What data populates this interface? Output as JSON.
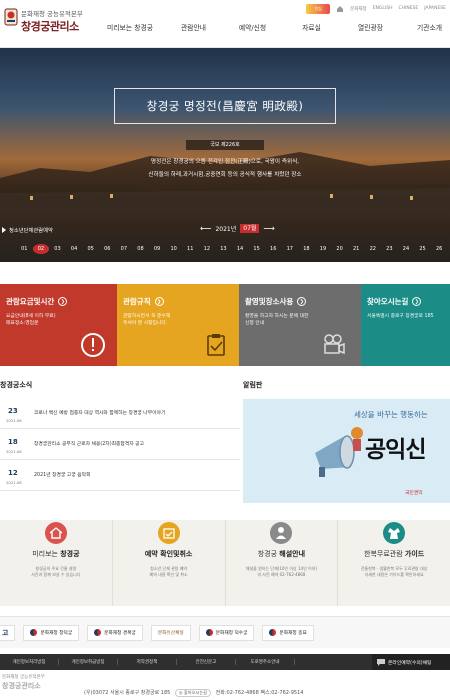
{
  "header": {
    "org": "문화재청 궁능유적본부",
    "site_name": "창경궁관리소",
    "util_links": [
      "홈",
      "문화재청",
      "ENGLISH",
      "CHINESE",
      "JAPANESE"
    ],
    "nav": [
      "미리보는 창경궁",
      "관람안내",
      "예약/신청",
      "자료실",
      "열린광장",
      "기관소개"
    ]
  },
  "hero": {
    "title": "창경궁 명정전(昌慶宮 明政殿)",
    "badge": "국보 제226호",
    "desc_line1": "명정전은 창경궁의 으뜸 전각인 정전(正殿)으로, 국왕이 즉위식,",
    "desc_line2": "신하들의 하례,과거시험,궁중연회 등의 공식적 행사를 치렀던 장소",
    "booking_label": "청소년단체관람예약",
    "year_label": "2021년",
    "month_label": "07월",
    "days": [
      "01",
      "02",
      "03",
      "04",
      "05",
      "06",
      "07",
      "08",
      "09",
      "10",
      "11",
      "12",
      "13",
      "14",
      "15",
      "16",
      "17",
      "18",
      "19",
      "20",
      "21",
      "22",
      "23",
      "24",
      "25",
      "26"
    ],
    "selected_day": "02"
  },
  "tiles": [
    {
      "title": "관람요금및시간",
      "desc": "요금안내(8세 이하 무료)\n매표정소:영업문",
      "color": "#c0392b"
    },
    {
      "title": "관람규칙",
      "desc": "관람하시면서 꼭 준수해\n주셔야 할 사항입니다.",
      "color": "#e6a520"
    },
    {
      "title": "촬영및장소사용",
      "desc": "촬영을 하고자 하시는 분에 대한\n신청 안내",
      "color": "#6d6d6d"
    },
    {
      "title": "찾아오시는길",
      "desc": "서울특별시 종로구 창경궁로 185",
      "color": "#1b8c86"
    }
  ],
  "news": {
    "title": "창경궁소식",
    "items": [
      {
        "day": "23",
        "ym": "2021.06",
        "text": "코로나 백신 예방 접종자 대상 역사와 함께하는 창경궁 나무이야기"
      },
      {
        "day": "18",
        "ym": "2021.06",
        "text": "창경궁관리소 공무직 근로자 채용(2차)최종합격자 공고"
      },
      {
        "day": "12",
        "ym": "2021.06",
        "text": "2021년 창경궁 고궁 음악회"
      }
    ]
  },
  "board": {
    "title": "알림판",
    "slogan": "세상을 바꾸는 행동하는",
    "big": "공익신",
    "foot": "국민권익"
  },
  "cards": [
    {
      "title_pre": "미리보는 ",
      "title_bold": "창경궁",
      "desc": "창경궁의 주요 건물 설명\n사진과 함께 보실 수 있습니다",
      "icon_color": "#d9534f"
    },
    {
      "title_pre": "예약 확인및취소",
      "title_bold": "",
      "desc": "청소년 단체 관람 예약\n예약 내용 확인 및 취소",
      "icon_color": "#e6a520"
    },
    {
      "title_pre": "창경궁 ",
      "title_bold": "해설안내",
      "desc": "해설을 원하는 단체(10인 이상 14인 이하)\n의 사전 예약 02-762-4868",
      "icon_color": "#7d7d7d"
    },
    {
      "title_pre": "한복무료관람 ",
      "title_bold": "가이드",
      "desc": "전통한복 · 생활한복 모두 무료관람 대상\n자세한 내용은 가이드를 확인하세요",
      "icon_color": "#1b8c86"
    }
  ],
  "partners": [
    "고",
    "문화재청 창덕궁",
    "문화재청 경복궁",
    "문화유산채널",
    "문화재청 덕수궁",
    "문화재청 종묘"
  ],
  "footer": {
    "links": [
      "개인정보처리방침",
      "개인정보취급방침",
      "저작권정책",
      "안전신문고",
      "도로명주소안내"
    ],
    "chat": "온라인예약(수의)채팅",
    "org": "문화재청 궁능유적본부",
    "name": "창경궁관리소",
    "addr_pre": "(우)03072 서울시 종로구 창경궁로 185",
    "map_label": "찾아오시는길",
    "addr_post": "전화:02-762-4868 팩스:02-762-9514"
  }
}
